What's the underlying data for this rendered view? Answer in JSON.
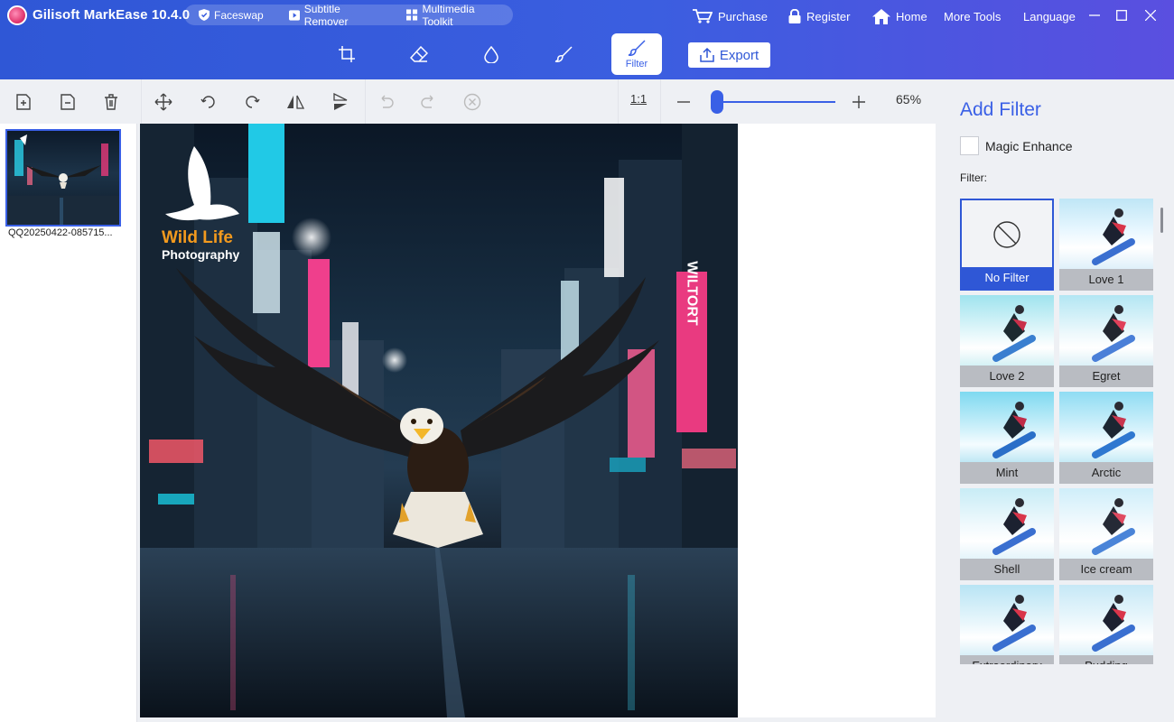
{
  "app": {
    "title": "Gilisoft MarkEase 10.4.0"
  },
  "promo": [
    {
      "label": "Faceswap",
      "icon": "shield-icon"
    },
    {
      "label": "Subtitle Remover",
      "icon": "play-icon"
    },
    {
      "label": "Multimedia Toolkit",
      "icon": "grid-icon"
    }
  ],
  "nav": {
    "purchase": "Purchase",
    "register": "Register",
    "home": "Home",
    "more_tools": "More Tools",
    "language": "Language"
  },
  "tools": {
    "active_label": "Filter",
    "items": [
      "crop-icon",
      "eraser-icon",
      "drop-icon",
      "brush-icon",
      "filter-icon"
    ]
  },
  "export": {
    "label": "Export"
  },
  "toolbar": {
    "ratio_label": "1:1",
    "zoom_percent": "65%",
    "zoom_level": 0.04
  },
  "file": {
    "name": "QQ20250422-085715..."
  },
  "photo": {
    "logo_line1": "Wild Life",
    "logo_line2": "Photography",
    "signs": [
      "WILTORT"
    ]
  },
  "panel": {
    "title": "Add Filter",
    "magic_enhance": "Magic Enhance",
    "magic_enhance_checked": false,
    "filter_label": "Filter:",
    "filters": [
      "No Filter",
      "Love 1",
      "Love 2",
      "Egret",
      "Mint",
      "Arctic",
      "Shell",
      "Ice cream",
      "Extraordinary",
      "Pudding"
    ],
    "selected": "No Filter"
  },
  "colors": {
    "accent": "#3a60e6",
    "title_bar": "#2f57d6"
  }
}
